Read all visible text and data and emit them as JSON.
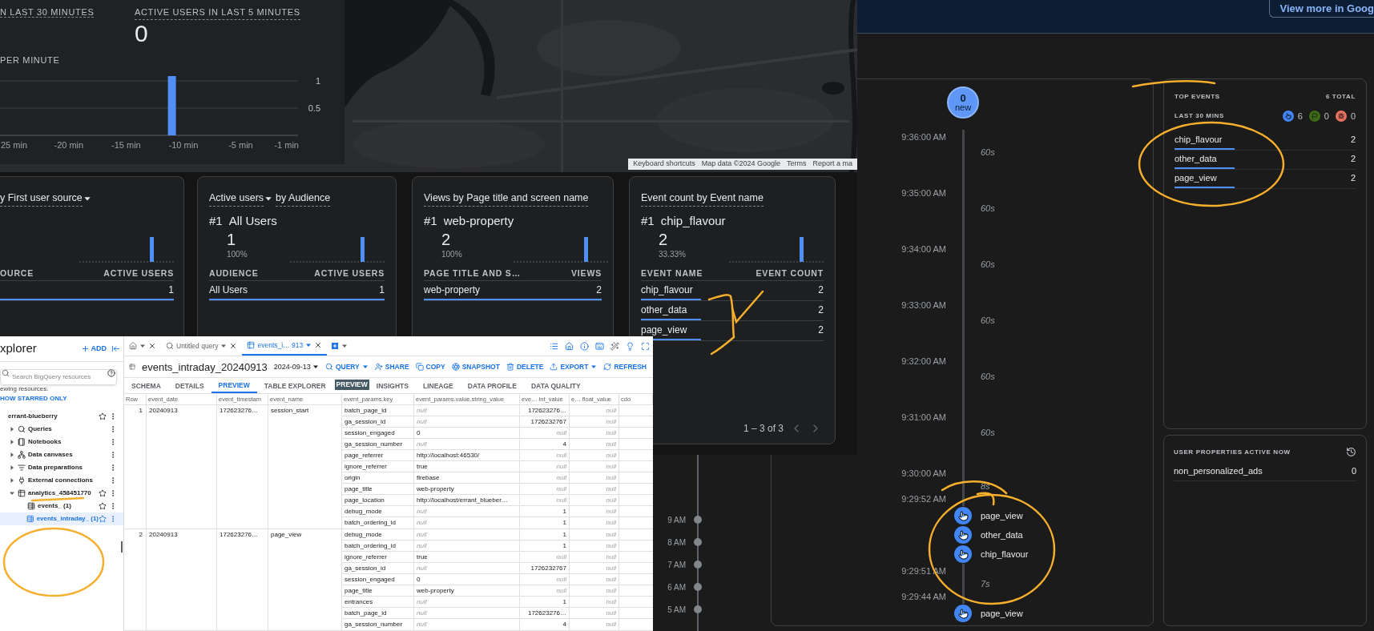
{
  "analytics": {
    "realtime": {
      "users_30_label": "N LAST 30 MINUTES",
      "users_5_label": "ACTIVE USERS IN LAST 5 MINUTES",
      "users_5_value": "0",
      "chart_data": {
        "type": "bar",
        "title": "PER MINUTE",
        "x": [
          -11
        ],
        "values": [
          1
        ],
        "xlim": [
          -26,
          0
        ],
        "ylim": [
          0,
          1
        ],
        "xticks": [
          {
            "value": -25,
            "label": "25 min"
          },
          {
            "value": -20,
            "label": "-20 min"
          },
          {
            "value": -15,
            "label": "-15 min"
          },
          {
            "value": -10,
            "label": "-10 min"
          },
          {
            "value": -5,
            "label": "-5 min"
          },
          {
            "value": -1,
            "label": "-1 min"
          }
        ],
        "yticks": [
          0.5,
          1
        ]
      }
    },
    "map": {
      "kind": "picture",
      "attribution": [
        "Keyboard shortcuts",
        "Map data ©2024 Google",
        "Terms",
        "Report a ma"
      ]
    },
    "cards": [
      {
        "title": [
          {
            "text": "y First user source",
            "dropdown": true
          }
        ],
        "columns": [
          "OURCE",
          "ACTIVE USERS"
        ],
        "rows": [
          {
            "value": "1",
            "level": 1
          }
        ]
      },
      {
        "title": [
          {
            "text": "Active users",
            "dropdown": true
          },
          {
            "text": "by Audience",
            "dropdown": false
          }
        ],
        "top": {
          "rank": "#1",
          "name": "All Users"
        },
        "value": "1",
        "share": "100%",
        "columns": [
          "AUDIENCE",
          "ACTIVE USERS"
        ],
        "rows": [
          {
            "name": "All Users",
            "value": "1",
            "level": 1
          }
        ]
      },
      {
        "title": [
          {
            "text": "Views by Page title and screen name",
            "dropdown": false
          }
        ],
        "top": {
          "rank": "#1",
          "name": "web-property"
        },
        "value": "2",
        "share": "100%",
        "columns": [
          "PAGE TITLE AND S…",
          "VIEWS"
        ],
        "rows": [
          {
            "name": "web-property",
            "value": "2",
            "level": 1
          }
        ]
      },
      {
        "title": [
          {
            "text": "Event count by Event name",
            "dropdown": false
          }
        ],
        "top": {
          "rank": "#1",
          "name": "chip_flavour"
        },
        "value": "2",
        "share": "33.33%",
        "columns": [
          "EVENT NAME",
          "EVENT COUNT"
        ],
        "rows": [
          {
            "name": "chip_flavour",
            "value": "2",
            "level": 0.33
          },
          {
            "name": "other_data",
            "value": "2",
            "level": 0.33
          },
          {
            "name": "page_view",
            "value": "2",
            "level": 0.33
          }
        ],
        "pager": "1 – 3 of 3"
      }
    ]
  },
  "bigquery": {
    "explorer": {
      "title": "xplorer",
      "add": "ADD",
      "search_placeholder": "Search BigQuery resources",
      "notice": "ewing resources.",
      "starred_link": "HOW STARRED ONLY",
      "tree": [
        {
          "label": "errant-blueberry",
          "kind": "project",
          "children": [
            {
              "label": "Queries",
              "kind": "queries",
              "expanded": false
            },
            {
              "label": "Notebooks",
              "kind": "notebooks",
              "expanded": false
            },
            {
              "label": "Data canvases",
              "kind": "canvases",
              "expanded": false
            },
            {
              "label": "Data preparations",
              "kind": "preparations",
              "expanded": false
            },
            {
              "label": "External connections",
              "kind": "connections",
              "expanded": false
            },
            {
              "label": "analytics_458451770",
              "kind": "dataset",
              "expanded": true,
              "children": [
                {
                  "label": "events_ (1)",
                  "kind": "table",
                  "selected": false
                },
                {
                  "label": "events_intraday_ (1)",
                  "kind": "table",
                  "selected": true
                }
              ]
            }
          ]
        }
      ]
    },
    "tabs": [
      {
        "kind": "home",
        "selected": false
      },
      {
        "kind": "query",
        "label": "Untitled query",
        "selected": false
      },
      {
        "kind": "table",
        "label": "events_i… 913",
        "selected": true
      }
    ],
    "table_title": "events_intraday_20240913",
    "date": "2024-09-13",
    "actions": [
      {
        "kind": "query",
        "label": "QUERY",
        "dropdown": true
      },
      {
        "kind": "share",
        "label": "SHARE",
        "dropdown": false
      },
      {
        "kind": "copy",
        "label": "COPY",
        "dropdown": false
      },
      {
        "kind": "snapshot",
        "label": "SNAPSHOT",
        "dropdown": false
      },
      {
        "kind": "delete",
        "label": "DELETE",
        "dropdown": false
      },
      {
        "kind": "export",
        "label": "EXPORT",
        "dropdown": true
      }
    ],
    "refresh": "REFRESH",
    "subtabs": [
      {
        "label": "SCHEMA",
        "selected": false
      },
      {
        "label": "DETAILS",
        "selected": false
      },
      {
        "label": "PREVIEW",
        "selected": true
      },
      {
        "label": "TABLE EXPLORER",
        "badge": "PREVIEW",
        "selected": false
      },
      {
        "label": "INSIGHTS",
        "selected": false
      },
      {
        "label": "LINEAGE",
        "selected": false
      },
      {
        "label": "DATA PROFILE",
        "selected": false
      },
      {
        "label": "DATA QUALITY",
        "selected": false
      }
    ],
    "grid": {
      "columns": [
        "Row",
        "event_date",
        "event_timestam",
        "event_name",
        "event_params.key",
        "event_params.value.string_value",
        "eve… int_value",
        "e… float_value",
        "cdo"
      ],
      "rows": [
        {
          "row": "1",
          "event_date": "20240913",
          "event_timestamp": "172623276…",
          "event_name": "session_start",
          "params": [
            {
              "cells": [
                "batch_page_id",
                "null",
                "172623276…",
                "null"
              ],
              "null_cells": [
                false,
                true,
                false,
                true
              ]
            },
            {
              "cells": [
                "ga_session_id",
                "null",
                "1726232767",
                "null"
              ],
              "null_cells": [
                false,
                true,
                false,
                true
              ]
            },
            {
              "cells": [
                "session_engaged",
                "0",
                "null",
                "null"
              ],
              "null_cells": [
                false,
                false,
                true,
                true
              ]
            },
            {
              "cells": [
                "ga_session_number",
                "null",
                "4",
                "null"
              ],
              "null_cells": [
                false,
                true,
                false,
                true
              ]
            },
            {
              "cells": [
                "page_referrer",
                "http://localhost:46530/",
                "null",
                "null"
              ],
              "null_cells": [
                false,
                false,
                true,
                true
              ]
            },
            {
              "cells": [
                "ignore_referrer",
                "true",
                "null",
                "null"
              ],
              "null_cells": [
                false,
                false,
                true,
                true
              ]
            },
            {
              "cells": [
                "origin",
                "firebase",
                "null",
                "null"
              ],
              "null_cells": [
                false,
                false,
                true,
                true
              ]
            },
            {
              "cells": [
                "page_title",
                "web-property",
                "null",
                "null"
              ],
              "null_cells": [
                false,
                false,
                true,
                true
              ]
            },
            {
              "cells": [
                "page_location",
                "http://localhost/errant_blueber…",
                "null",
                "null"
              ],
              "null_cells": [
                false,
                false,
                true,
                true
              ]
            },
            {
              "cells": [
                "debug_mode",
                "null",
                "1",
                "null"
              ],
              "null_cells": [
                false,
                true,
                false,
                true
              ]
            },
            {
              "cells": [
                "batch_ordering_id",
                "null",
                "1",
                "null"
              ],
              "null_cells": [
                false,
                true,
                false,
                true
              ]
            }
          ]
        },
        {
          "row": "2",
          "event_date": "20240913",
          "event_timestamp": "172623276…",
          "event_name": "page_view",
          "params": [
            {
              "cells": [
                "debug_mode",
                "null",
                "1",
                "null"
              ],
              "null_cells": [
                false,
                true,
                false,
                true
              ]
            },
            {
              "cells": [
                "batch_ordering_id",
                "null",
                "1",
                "null"
              ],
              "null_cells": [
                false,
                true,
                false,
                true
              ]
            },
            {
              "cells": [
                "ignore_referrer",
                "true",
                "null",
                "null"
              ],
              "null_cells": [
                false,
                false,
                true,
                true
              ]
            },
            {
              "cells": [
                "ga_session_id",
                "null",
                "1726232767",
                "null"
              ],
              "null_cells": [
                false,
                true,
                false,
                true
              ]
            },
            {
              "cells": [
                "session_engaged",
                "0",
                "null",
                "null"
              ],
              "null_cells": [
                false,
                false,
                true,
                true
              ]
            },
            {
              "cells": [
                "page_title",
                "web-property",
                "null",
                "null"
              ],
              "null_cells": [
                false,
                false,
                true,
                true
              ]
            },
            {
              "cells": [
                "entrances",
                "null",
                "1",
                "null"
              ],
              "null_cells": [
                false,
                true,
                false,
                true
              ]
            },
            {
              "cells": [
                "batch_page_id",
                "null",
                "172623276…",
                "null"
              ],
              "null_cells": [
                false,
                true,
                false,
                true
              ]
            },
            {
              "cells": [
                "ga_session_number",
                "null",
                "4",
                "null"
              ],
              "null_cells": [
                false,
                true,
                false,
                true
              ]
            }
          ]
        }
      ]
    }
  },
  "debugview": {
    "header_button": "View more in Goog",
    "minute_labels": [
      "9 AM",
      "8 AM",
      "7 AM",
      "6 AM",
      "5 AM"
    ],
    "timeline": {
      "new_count": "0",
      "new_label": "new",
      "entries": [
        {
          "kind": "time",
          "text": "9:36:00 AM"
        },
        {
          "kind": "gap",
          "text": "60s"
        },
        {
          "kind": "time",
          "text": "9:35:00 AM"
        },
        {
          "kind": "gap",
          "text": "60s"
        },
        {
          "kind": "time",
          "text": "9:34:00 AM"
        },
        {
          "kind": "gap",
          "text": "60s"
        },
        {
          "kind": "time",
          "text": "9:33:00 AM"
        },
        {
          "kind": "gap",
          "text": "60s"
        },
        {
          "kind": "time",
          "text": "9:32:00 AM"
        },
        {
          "kind": "gap",
          "text": "60s"
        },
        {
          "kind": "time",
          "text": "9:31:00 AM"
        },
        {
          "kind": "gap",
          "text": "60s"
        },
        {
          "kind": "time",
          "text": "9:30:00 AM"
        },
        {
          "kind": "short_gap",
          "text": "8s"
        },
        {
          "kind": "time",
          "text": "9:29:52 AM"
        },
        {
          "kind": "event",
          "text": "page_view"
        },
        {
          "kind": "event",
          "text": "other_data"
        },
        {
          "kind": "event",
          "text": "chip_flavour"
        },
        {
          "kind": "time",
          "text": "9:29:51 AM"
        },
        {
          "kind": "short_gap",
          "text": "7s"
        },
        {
          "kind": "time",
          "text": "9:29:44 AM"
        },
        {
          "kind": "event",
          "text": "page_view"
        }
      ]
    },
    "top_events": {
      "title": "TOP EVENTS",
      "total": "6 TOTAL",
      "period": "LAST 30 MINS",
      "counters": [
        {
          "kind": "event",
          "value": "6",
          "color": "#4285f4"
        },
        {
          "kind": "conversion",
          "value": "0",
          "color": "#3d6b16"
        },
        {
          "kind": "error",
          "value": "0",
          "color": "#e8705f"
        }
      ],
      "rows": [
        {
          "name": "chip_flavour",
          "count": "2",
          "level": 0.33
        },
        {
          "name": "other_data",
          "count": "2",
          "level": 0.33
        },
        {
          "name": "page_view",
          "count": "2",
          "level": 0.33
        }
      ]
    },
    "user_properties": {
      "title": "USER PROPERTIES ACTIVE NOW",
      "rows": [
        {
          "name": "non_personalized_ads",
          "value": "0"
        }
      ]
    }
  }
}
